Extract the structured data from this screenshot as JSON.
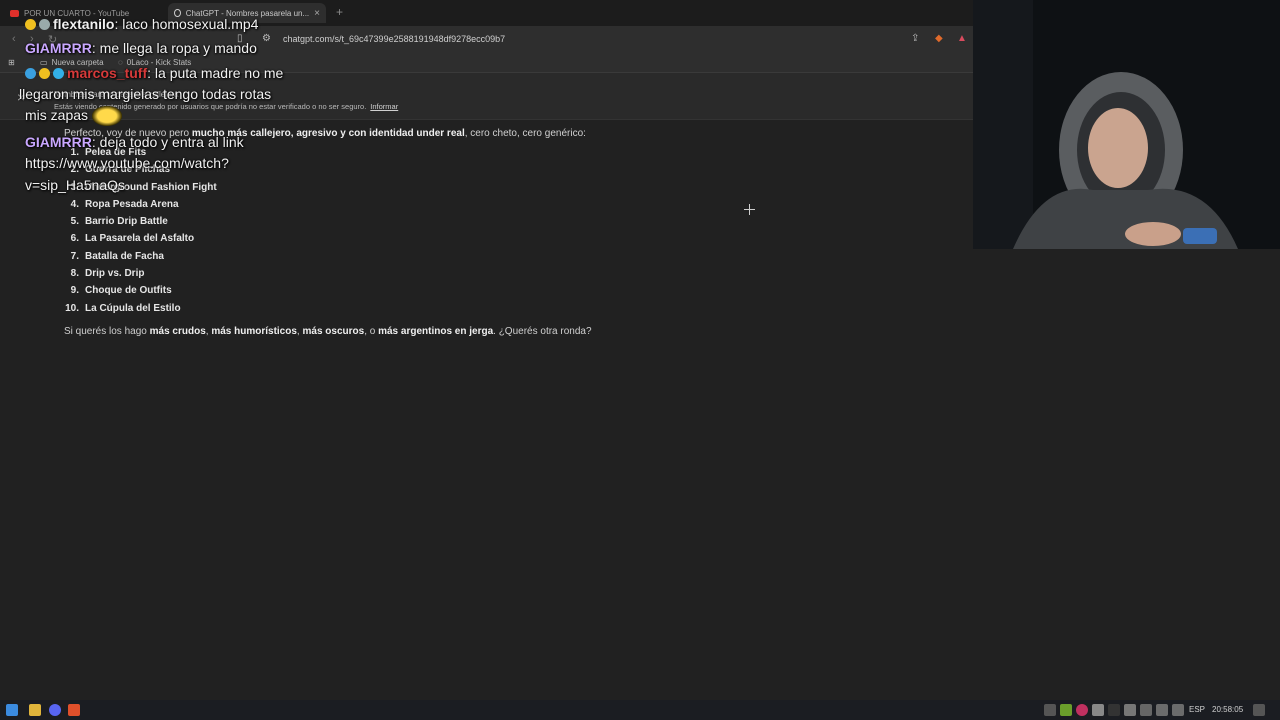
{
  "browser": {
    "tabs": [
      {
        "label": "POR UN CUARTO - YouTube",
        "active": false
      },
      {
        "label": "ChatGPT - Nombres pasarela un...",
        "active": true
      }
    ],
    "new_tab_label": "+",
    "url": "chatgpt.com/s/t_69c47399e2588191948df9278ecc09b7",
    "bookmarks": [
      {
        "label": "Nueva carpeta",
        "icon": "folder-icon"
      },
      {
        "label": "0Laco - Kick Stats",
        "icon": "chart-icon"
      }
    ]
  },
  "banner": {
    "title": "Nombres para tu pasarela callejera",
    "message": "Estás viendo contenido generado por usuarios que podría no estar verificado o no ser seguro.",
    "link": "Informar"
  },
  "content": {
    "intro_prefix": "Perfecto, voy de nuevo pero ",
    "intro_bold": "mucho más callejero, agresivo y con identidad under real",
    "intro_suffix": ", cero cheto, cero genérico:",
    "list": [
      {
        "num": "1.",
        "text": "Pelea de Fits"
      },
      {
        "num": "2.",
        "text": "Guerra de Pilchas"
      },
      {
        "num": "3.",
        "text": "Underground Fashion Fight"
      },
      {
        "num": "4.",
        "text": "Ropa Pesada Arena"
      },
      {
        "num": "5.",
        "text": "Barrio Drip Battle"
      },
      {
        "num": "6.",
        "text": "La Pasarela del Asfalto"
      },
      {
        "num": "7.",
        "text": "Batalla de Facha"
      },
      {
        "num": "8.",
        "text": "Drip vs. Drip"
      },
      {
        "num": "9.",
        "text": "Choque de Outfits"
      },
      {
        "num": "10.",
        "text": "La Cúpula del Estilo"
      }
    ],
    "outro": {
      "p1": "Si querés los hago ",
      "b1": "más crudos",
      "p2": ", ",
      "b2": "más humorísticos",
      "p3": ", ",
      "b3": "más oscuros",
      "p4": ", o ",
      "b4": "más argentinos en jerga",
      "p5": ". ¿Querés otra ronda?"
    }
  },
  "chat": [
    {
      "user": "flextanilo",
      "text": ": laco homosexual.mp4"
    },
    {
      "user": "GIAMRRR",
      "text": ": me llega la ropa y mando"
    },
    {
      "user": "marcos_tuff",
      "text": ": la puta madre no me"
    },
    {
      "user": "",
      "text": "llegaron mis margielas tengo todas rotas"
    },
    {
      "user": "",
      "text": "mis zapas"
    },
    {
      "user": "GIAMRRR",
      "text": ": deja todo y entra al link"
    },
    {
      "user": "",
      "text": "https://www.youtube.com/watch?"
    },
    {
      "user": "",
      "text": "v=sip_Ha5naQs"
    }
  ],
  "taskbar": {
    "language": "ESP",
    "time": "20:58:05"
  },
  "colors": {
    "page_bg": "#212121",
    "accent_user_giam": "#c9a7ff",
    "accent_user_marcos": "#d63a3a"
  }
}
